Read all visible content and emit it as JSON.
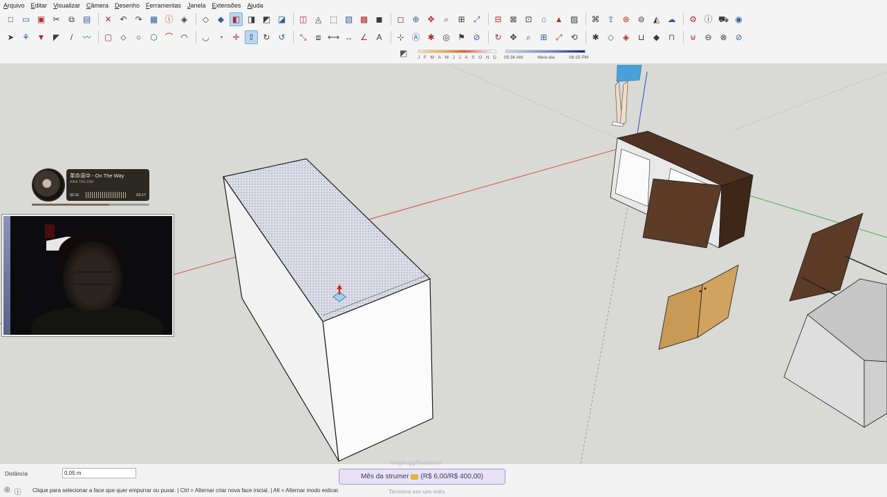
{
  "menubar": {
    "items": [
      "Arquivo",
      "Editar",
      "Visualizar",
      "Câmera",
      "Desenho",
      "Ferramentas",
      "Janela",
      "Extensões",
      "Ajuda"
    ]
  },
  "toolbar_top": {
    "icons": [
      "new-icon",
      "open-icon",
      "save-icon",
      "cut-icon",
      "copy-icon",
      "paste-icon",
      "erase-icon",
      "undo-icon",
      "redo-icon",
      "print-icon",
      "model-info-icon",
      "iso-view-icon",
      "top-view-icon",
      "front-view-icon",
      "right-view-icon",
      "back-view-icon",
      "left-view-icon",
      "bottom-view-icon",
      "xray-icon",
      "back-edges-icon",
      "wireframe-icon",
      "hidden-line-icon",
      "shaded-icon",
      "shaded-textures-icon",
      "monochrome-icon",
      "orbit-icon",
      "pan-icon",
      "zoom-icon",
      "zoom-window-icon",
      "zoom-extents-icon",
      "section-plane-icon",
      "display-section-icon",
      "section-cuts-icon",
      "add-location-icon",
      "terrain-icon",
      "photo-texture-icon",
      "warehouse-icon",
      "share-model-icon",
      "extension-warehouse-icon",
      "layout-icon",
      "trimble-icon",
      "cloud-icon",
      "settings-icon",
      "info-icon",
      "cart-icon",
      "account-icon"
    ],
    "active_index": 14
  },
  "toolbar_bottom": {
    "icons": [
      "select-icon",
      "component-icon",
      "paint-bucket-icon",
      "eraser-icon",
      "line-icon",
      "freehand-icon",
      "rectangle-icon",
      "rotated-rectangle-icon",
      "circle-icon",
      "polygon-icon",
      "arc-icon",
      "two-point-arc-icon",
      "three-point-arc-icon",
      "pie-icon",
      "move-icon",
      "push-pull-icon",
      "rotate-icon",
      "follow-me-icon",
      "scale-icon",
      "offset-icon",
      "tape-measure-icon",
      "dimension-icon",
      "protractor-icon",
      "text-icon",
      "axes-icon",
      "3d-text-icon",
      "walk-icon",
      "look-around-icon",
      "position-camera-icon",
      "section-icon",
      "orbit-tool-icon",
      "pan-tool-icon",
      "zoom-tool-icon",
      "zoom-window-tool-icon",
      "zoom-extents-tool-icon",
      "previous-view-icon",
      "walk-tool-icon",
      "sandbox-smoove-icon",
      "sandbox-stamp-icon",
      "sandbox-drape-icon",
      "solid-outer-shell-icon",
      "solid-intersect-icon",
      "solid-union-icon",
      "solid-subtract-icon",
      "solid-trim-icon",
      "solid-split-icon"
    ],
    "active_index": 15
  },
  "shadows": {
    "months": [
      "J",
      "F",
      "M",
      "A",
      "M",
      "J",
      "J",
      "A",
      "S",
      "O",
      "N",
      "D"
    ],
    "time_labels": [
      "05:36 AM",
      "Meio-dia",
      "06:15 PM"
    ],
    "month_position": 0.85,
    "time_position": 0.6
  },
  "music_widget": {
    "title": "革命道中 - On The Way",
    "artist": "AINA THE END",
    "time_current": "02:11",
    "time_total": "03:17",
    "progress": 0.66
  },
  "measurements": {
    "label": "Distância",
    "value": "0,05 m"
  },
  "status_bar": {
    "hint": "Clique para selecionar a face que quer empurrar ou puxar. | Ctrl = Alternar criar nova face inicial. | Alt = Alternar modo esticar."
  },
  "stream_overlay": {
    "top_text": "livepix.gg/ltsmarcel",
    "goal_text": "Mês da strumer",
    "goal_progress": "(R$ 6,00/R$ 400,00)",
    "goal_footer": "Termina em um mês"
  },
  "colors": {
    "sky": "#dcdcd7",
    "ground": "#d9d9d6",
    "red_axis": "#c63f3f",
    "green_axis": "#3fb04a",
    "blue_axis": "#3347c6",
    "selection": "#aeb1cf",
    "wood_dark": "#5a3a26",
    "wood_light": "#c99a55"
  }
}
